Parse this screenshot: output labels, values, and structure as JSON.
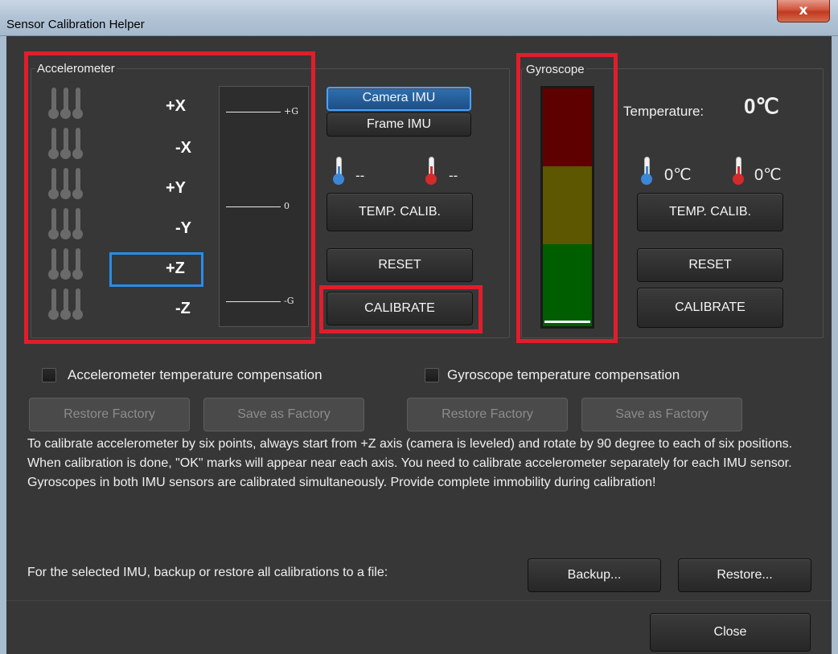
{
  "window": {
    "title": "Sensor Calibration Helper",
    "close_glyph": "x"
  },
  "accelerometer": {
    "title": "Accelerometer",
    "axes": [
      "+X",
      "-X",
      "+Y",
      "-Y",
      "+Z",
      "-Z"
    ],
    "selected_axis": "+Z",
    "gauge": {
      "top_label": "+G",
      "mid_label": "0",
      "bottom_label": "-G"
    }
  },
  "imu": {
    "camera_label": "Camera IMU",
    "frame_label": "Frame IMU",
    "selected": "Camera IMU",
    "temp_cold": "--",
    "temp_hot": "--",
    "temp_calib_label": "TEMP. CALIB.",
    "reset_label": "RESET",
    "calibrate_label": "CALIBRATE"
  },
  "gyroscope": {
    "title": "Gyroscope",
    "temperature_label": "Temperature:",
    "temperature_value": "0℃",
    "temp_cold": "0℃",
    "temp_hot": "0℃",
    "temp_calib_label": "TEMP. CALIB.",
    "reset_label": "RESET",
    "calibrate_label": "CALIBRATE",
    "level": 0,
    "zone_colors": [
      "#5e0000",
      "#5c5700",
      "#005d00"
    ]
  },
  "compensation": {
    "accel_label": "Accelerometer temperature compensation",
    "gyro_label": "Gyroscope temperature compensation",
    "accel_checked": false,
    "gyro_checked": false
  },
  "factory": {
    "accel_restore": "Restore Factory",
    "accel_save": "Save as Factory",
    "gyro_restore": "Restore Factory",
    "gyro_save": "Save as Factory"
  },
  "description": {
    "line1": "To calibrate accelerometer by six points, always start from +Z axis (camera is leveled) and rotate by 90 degree to each of six positions. When calibration is done, \"OK\" marks will appear near each axis. You need to calibrate accelerometer separately for each IMU sensor.",
    "line2": "Gyroscopes in both IMU sensors are calibrated simultaneously. Provide complete immobility during calibration!"
  },
  "backup": {
    "label": "For the selected IMU, backup or restore all calibrations to a file:",
    "backup_button": "Backup...",
    "restore_button": "Restore..."
  },
  "footer": {
    "close_button": "Close"
  },
  "colors": {
    "highlight_red": "#e01e2b",
    "selection_blue": "#2b8ce8",
    "thermo_cold": "#3c86d6",
    "thermo_hot": "#d42a2a"
  }
}
